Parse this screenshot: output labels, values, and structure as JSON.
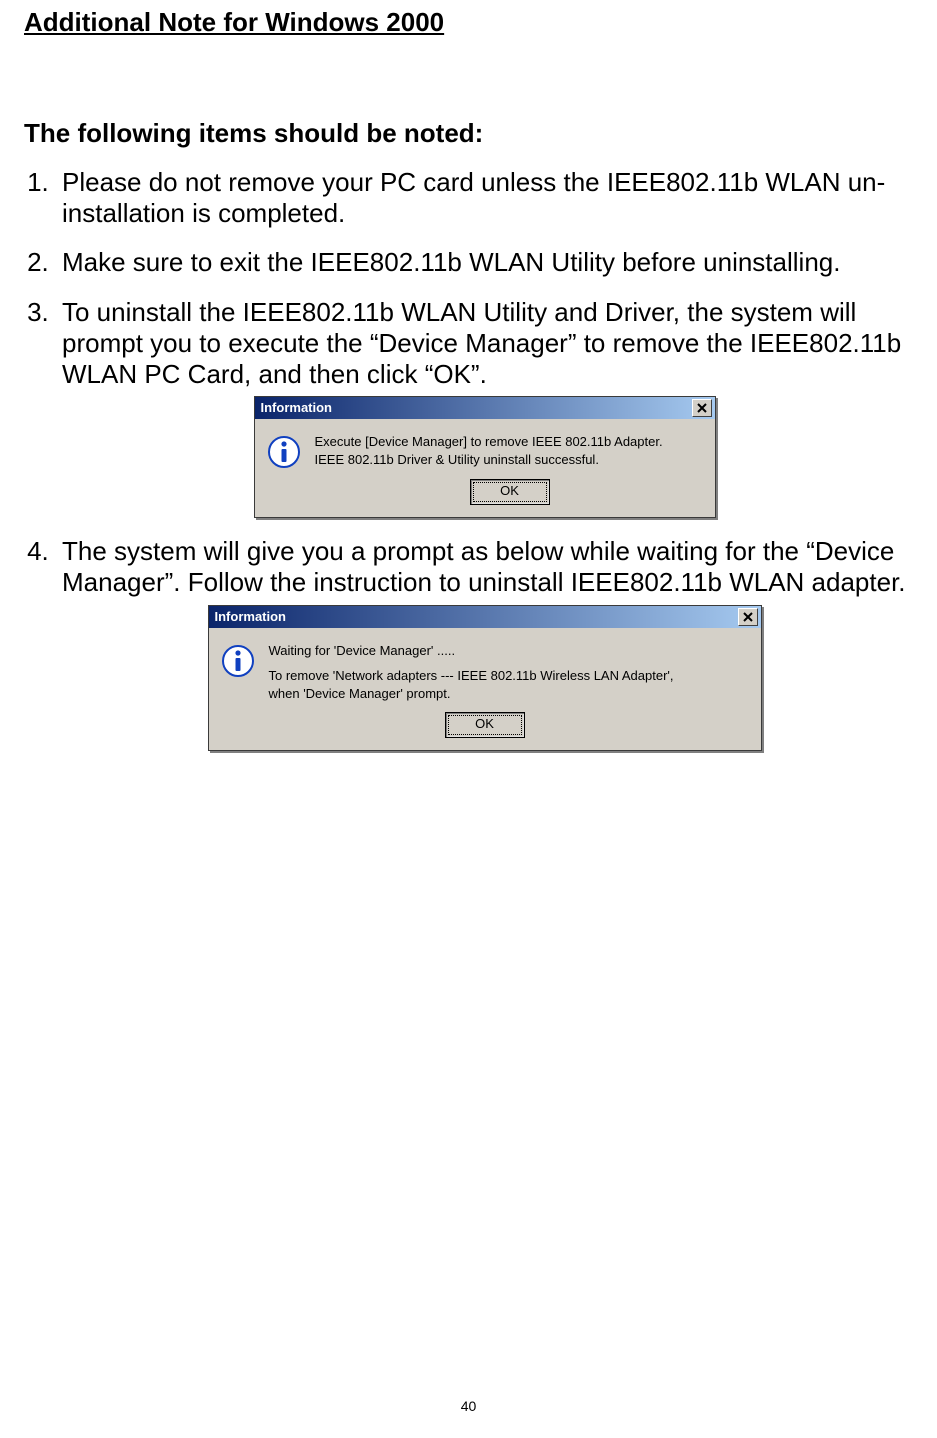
{
  "headings": {
    "section": "Additional Note for Windows 2000",
    "sub": "The following items should be noted:"
  },
  "list": {
    "item1": "Please do not remove your PC card unless the IEEE802.11b WLAN un-installation is completed.",
    "item2": "Make sure to exit the IEEE802.11b WLAN Utility before uninstalling.",
    "item3": "To uninstall the IEEE802.11b WLAN Utility and Driver, the system will prompt you to execute the “Device Manager” to remove the IEEE802.11b WLAN PC Card, and then click “OK”.",
    "item4": "The system will give you a prompt as below while waiting for the “Device Manager”. Follow the instruction to uninstall IEEE802.11b WLAN adapter."
  },
  "dialog1": {
    "title": "Information",
    "line1": "Execute [Device Manager] to remove IEEE 802.11b Adapter.",
    "line2": "IEEE 802.11b Driver & Utility uninstall successful.",
    "ok": "OK"
  },
  "dialog2": {
    "title": "Information",
    "line1": "Waiting for 'Device Manager' .....",
    "line2": "To remove 'Network adapters --- IEEE 802.11b Wireless LAN Adapter',",
    "line3": "when 'Device Manager' prompt.",
    "ok": "OK"
  },
  "page_number": "40"
}
